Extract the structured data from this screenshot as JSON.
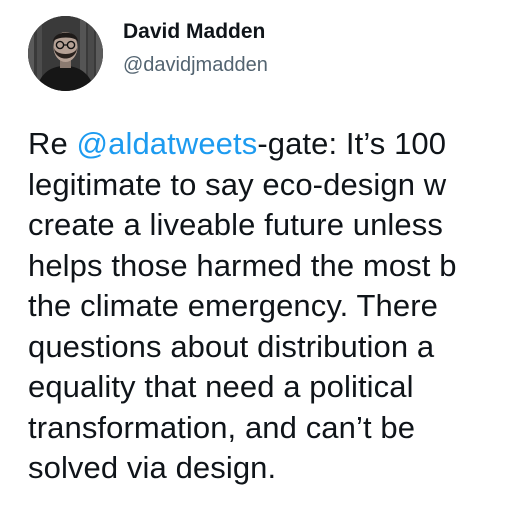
{
  "author": {
    "name": "David Madden",
    "handle": "@davidjmadden"
  },
  "tweet": {
    "line1": {
      "prefix": "Re ",
      "mention": "@aldatweets",
      "suffix": "-gate: It’s 100"
    },
    "lines": [
      "legitimate to say eco-design w",
      "create a liveable future unless",
      "helps those harmed the most b",
      "the climate emergency. There",
      "questions about distribution a",
      "equality that need a political",
      "transformation, and can’t be",
      "solved via design."
    ]
  },
  "colors": {
    "text": "#0f1419",
    "secondary": "#536471",
    "link": "#1d9bf0"
  }
}
